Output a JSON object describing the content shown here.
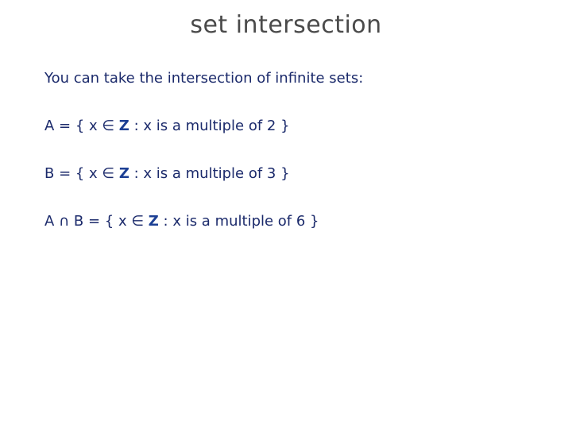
{
  "slide": {
    "title": "set intersection",
    "intro": "You can take the intersection of infinite sets:",
    "lines": [
      {
        "pre": "A = { x ∈ ",
        "z": "Z",
        "post": " : x is a multiple of 2 }"
      },
      {
        "pre": "B = { x ∈ ",
        "z": "Z",
        "post": " : x is a multiple of 3 }"
      },
      {
        "pre": "A ∩ B = { x ∈ ",
        "z": "Z",
        "post": " : x is a multiple of 6 }"
      }
    ]
  }
}
